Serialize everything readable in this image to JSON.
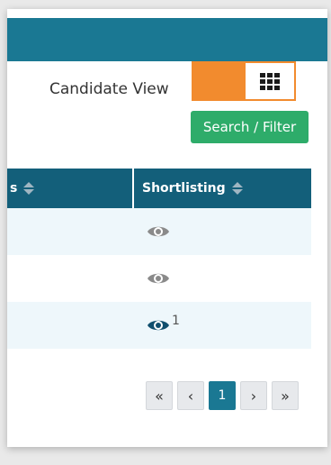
{
  "header": {
    "candidate_view_label": "Candidate View"
  },
  "view_toggle": {
    "grid_icon": "grid-icon"
  },
  "search_filter": {
    "label": "Search / Filter"
  },
  "table": {
    "columns": [
      {
        "label": "s",
        "sortable": true
      },
      {
        "label": "Shortlisting",
        "sortable": true
      }
    ],
    "rows": [
      {
        "shortlisting_icon": "eye-icon",
        "count": ""
      },
      {
        "shortlisting_icon": "eye-icon",
        "count": ""
      },
      {
        "shortlisting_icon": "eye-icon-active",
        "count": "1"
      }
    ]
  },
  "pagination": {
    "first": "«",
    "prev": "‹",
    "current": "1",
    "next": "›",
    "last": "»"
  },
  "colors": {
    "header_bar": "#1a7893",
    "table_header": "#135f7a",
    "toggle": "#f28b2e",
    "search_button": "#2eac6a",
    "eye_inactive": "#8a8a8a",
    "eye_active": "#0f4e6d"
  }
}
